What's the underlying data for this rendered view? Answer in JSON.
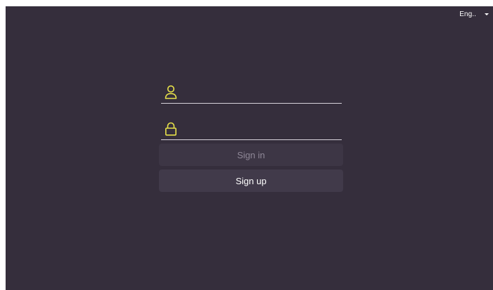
{
  "language": {
    "selected": "Eng.."
  },
  "login_form": {
    "username": {
      "icon": "user-icon",
      "value": "",
      "placeholder": ""
    },
    "password": {
      "icon": "lock-icon",
      "value": "",
      "placeholder": ""
    },
    "signin_label": "Sign in",
    "signup_label": "Sign up"
  },
  "colors": {
    "background": "#352e3c",
    "accent": "#e8e24a",
    "signin_button_bg": "#3d3645",
    "signin_text_disabled": "#8f8897",
    "signup_button_bg": "#413a4a",
    "text": "#ffffff"
  }
}
